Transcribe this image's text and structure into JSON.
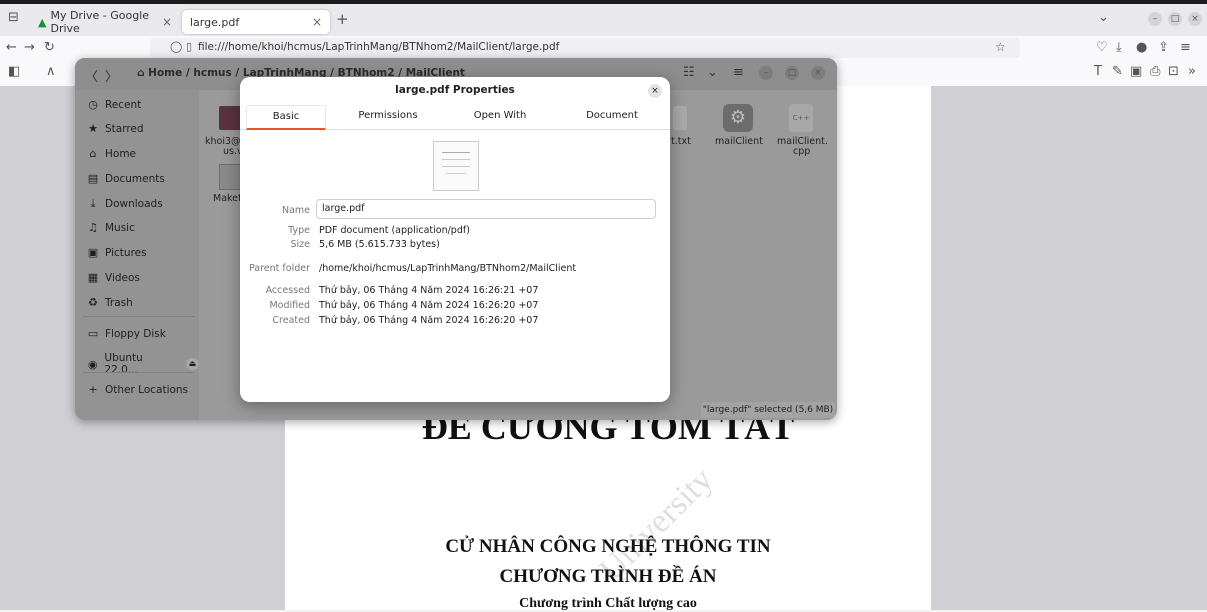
{
  "browser": {
    "tabs": [
      {
        "label": "My Drive - Google Drive",
        "close": "×"
      },
      {
        "label": "large.pdf",
        "close": "×"
      }
    ],
    "new_tab": "+",
    "url": "file:///home/khoi/hcmus/LapTrinhMang/BTNhom2/MailClient/large.pdf"
  },
  "pdf": {
    "heading": "ĐỀ CƯƠNG TÓM TẮT",
    "line1": "CỬ NHÂN CÔNG NGHỆ THÔNG TIN",
    "line2": "CHƯƠNG TRÌNH ĐỀ ÁN",
    "line3": "Chương trình Chất lượng cao",
    "watermark": "University"
  },
  "file_manager": {
    "breadcrumb": [
      "Home",
      "hcmus",
      "LapTrinhMang",
      "BTNhom2",
      "MailClient"
    ],
    "sidebar": [
      {
        "label": "Recent",
        "icon": "clock-icon"
      },
      {
        "label": "Starred",
        "icon": "star-icon"
      },
      {
        "label": "Home",
        "icon": "home-icon"
      },
      {
        "label": "Documents",
        "icon": "document-icon"
      },
      {
        "label": "Downloads",
        "icon": "download-icon"
      },
      {
        "label": "Music",
        "icon": "music-icon"
      },
      {
        "label": "Pictures",
        "icon": "picture-icon"
      },
      {
        "label": "Videos",
        "icon": "video-icon"
      },
      {
        "label": "Trash",
        "icon": "trash-icon"
      },
      {
        "label": "Floppy Disk",
        "icon": "floppy-icon"
      },
      {
        "label": "Ubuntu 22.0...",
        "icon": "disc-icon"
      },
      {
        "label": "Other Locations",
        "icon": "plus-icon"
      }
    ],
    "files": {
      "f1": "khoi3@",
      "f1b": "us.vi",
      "f2": "Makef",
      "f3": "t.txt",
      "f4": "mailClient",
      "f5": "mailClient.",
      "f5b": "cpp",
      "cpp_badge": "C++"
    },
    "status": "\"large.pdf\" selected (5,6 MB)"
  },
  "dialog": {
    "title": "large.pdf Properties",
    "tabs": [
      "Basic",
      "Permissions",
      "Open With",
      "Document"
    ],
    "name_label": "Name",
    "name_value": "large.pdf",
    "type_label": "Type",
    "type_value": "PDF document (application/pdf)",
    "size_label": "Size",
    "size_value": "5,6 MB (5.615.733 bytes)",
    "parent_label": "Parent folder",
    "parent_value": "/home/khoi/hcmus/LapTrinhMang/BTNhom2/MailClient",
    "accessed_label": "Accessed",
    "accessed_value": "Thứ bảy, 06 Tháng 4 Năm 2024 16:26:21 +07",
    "modified_label": "Modified",
    "modified_value": "Thứ bảy, 06 Tháng 4 Năm 2024 16:26:20 +07",
    "created_label": "Created",
    "created_value": "Thứ bảy, 06 Tháng 4 Năm 2024 16:26:20 +07"
  }
}
